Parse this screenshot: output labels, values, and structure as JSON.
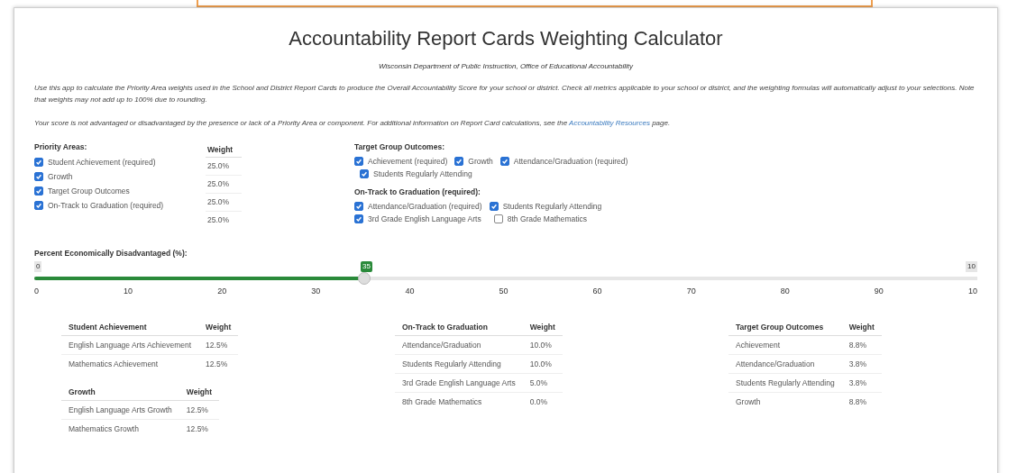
{
  "title": "Accountability Report Cards Weighting Calculator",
  "subtitle": "Wisconsin Department of Public Instruction, Office of Educational Accountability",
  "intro": "Use this app to calculate the Priority Area weights used in the School and District Report Cards to produce the Overall Accountability Score for your school or district. Check all metrics applicable to your school or district, and the weighting formulas will automatically adjust to your selections. Note that weights may not add up to 100% due to rounding.",
  "note": {
    "before": "Your score is not advantaged or disadvantaged by the presence or lack of a Priority Area or component. For additional information on Report Card calculations, see the",
    "link": "Accountability Resources",
    "after": "page."
  },
  "priority_areas": {
    "heading": "Priority Areas:",
    "weight_heading": "Weight",
    "items": [
      {
        "label": "Student Achievement (required)",
        "checked": true
      },
      {
        "label": "Growth",
        "checked": true
      },
      {
        "label": "Target Group Outcomes",
        "checked": true
      },
      {
        "label": "On-Track to Graduation (required)",
        "checked": true
      }
    ],
    "weights": [
      "25.0%",
      "25.0%",
      "25.0%",
      "25.0%"
    ]
  },
  "groups": [
    {
      "heading": "Target Group Outcomes:",
      "items": [
        {
          "label": "Achievement (required)",
          "checked": true
        },
        {
          "label": "Growth",
          "checked": true
        },
        {
          "label": "Attendance/Graduation (required)",
          "checked": true
        },
        {
          "label": "Students Regularly Attending",
          "checked": true
        }
      ]
    },
    {
      "heading": "On-Track to Graduation (required):",
      "items": [
        {
          "label": "Attendance/Graduation (required)",
          "checked": true
        },
        {
          "label": "Students Regularly Attending",
          "checked": true
        },
        {
          "label": "3rd Grade English Language Arts",
          "checked": true
        },
        {
          "label": "8th Grade Mathematics",
          "checked": false
        }
      ]
    }
  ],
  "slider": {
    "label": "Percent Economically Disadvantaged (%):",
    "min_label": "0",
    "max_label": "10",
    "value_label": "35",
    "level": 0.35,
    "ticks": [
      "0",
      "10",
      "20",
      "30",
      "40",
      "50",
      "60",
      "70",
      "80",
      "90",
      "10"
    ]
  },
  "table_columns": [
    [
      {
        "columns": [
          "Student Achievement",
          "Weight"
        ],
        "rows": [
          [
            "English Language Arts Achievement",
            "12.5%"
          ],
          [
            "Mathematics Achievement",
            "12.5%"
          ]
        ]
      },
      {
        "columns": [
          "Growth",
          "Weight"
        ],
        "rows": [
          [
            "English Language Arts Growth",
            "12.5%"
          ],
          [
            "Mathematics Growth",
            "12.5%"
          ]
        ]
      }
    ],
    [
      {
        "columns": [
          "On-Track to Graduation",
          "Weight"
        ],
        "rows": [
          [
            "Attendance/Graduation",
            "10.0%"
          ],
          [
            "Students Regularly Attending",
            "10.0%"
          ],
          [
            "3rd Grade English Language Arts",
            "5.0%"
          ],
          [
            "8th Grade Mathematics",
            "0.0%"
          ]
        ]
      }
    ],
    [
      {
        "columns": [
          "Target Group Outcomes",
          "Weight"
        ],
        "rows": [
          [
            "Achievement",
            "8.8%"
          ],
          [
            "Attendance/Graduation",
            "3.8%"
          ],
          [
            "Students Regularly Attending",
            "3.8%"
          ],
          [
            "Growth",
            "8.8%"
          ]
        ]
      }
    ]
  ]
}
